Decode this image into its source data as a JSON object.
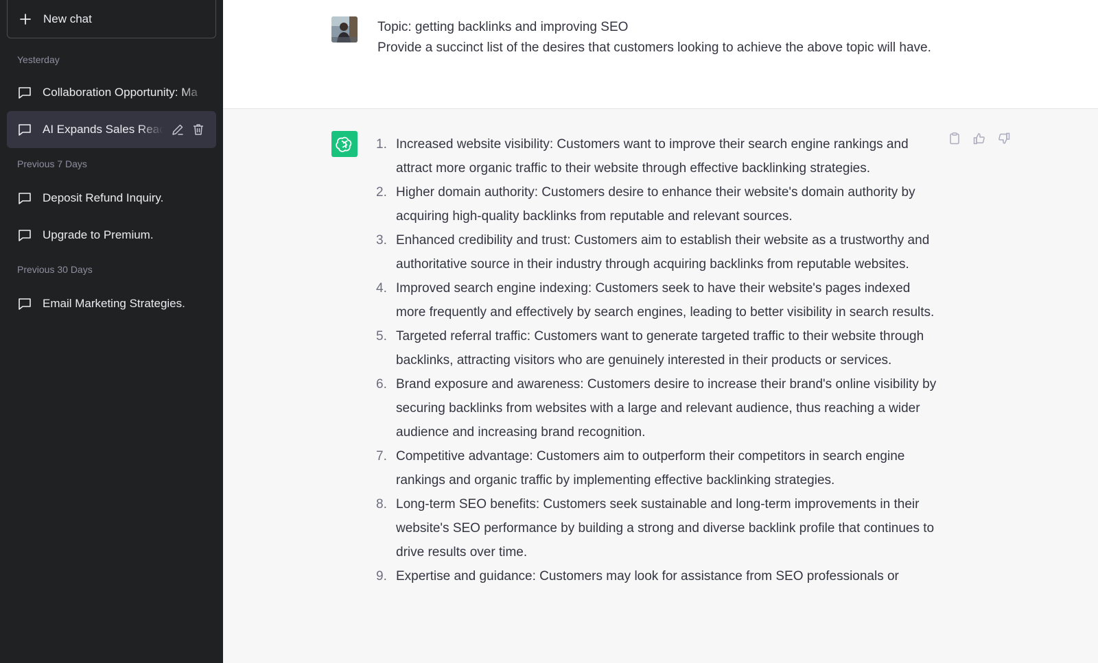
{
  "sidebar": {
    "new_chat_label": "New chat",
    "sections": [
      {
        "label": "Yesterday",
        "items": [
          {
            "label": "Collaboration Opportunity: Ma"
          },
          {
            "label": "AI Expands Sales Reac"
          }
        ]
      },
      {
        "label": "Previous 7 Days",
        "items": [
          {
            "label": "Deposit Refund Inquiry."
          },
          {
            "label": "Upgrade to Premium."
          }
        ]
      },
      {
        "label": "Previous 30 Days",
        "items": [
          {
            "label": "Email Marketing Strategies."
          }
        ]
      }
    ]
  },
  "conversation": {
    "user_message": {
      "line1": "Topic: getting backlinks and improving SEO",
      "line2": "Provide a succinct list of the desires that customers looking to achieve the above topic will have."
    },
    "assistant_items": [
      {
        "num": "1.",
        "text": "Increased website visibility: Customers want to improve their search engine rankings and attract more organic traffic to their website through effective backlinking strategies."
      },
      {
        "num": "2.",
        "text": "Higher domain authority: Customers desire to enhance their website's domain authority by acquiring high-quality backlinks from reputable and relevant sources."
      },
      {
        "num": "3.",
        "text": "Enhanced credibility and trust: Customers aim to establish their website as a trustworthy and authoritative source in their industry through acquiring backlinks from reputable websites."
      },
      {
        "num": "4.",
        "text": "Improved search engine indexing: Customers seek to have their website's pages indexed more frequently and effectively by search engines, leading to better visibility in search results."
      },
      {
        "num": "5.",
        "text": "Targeted referral traffic: Customers want to generate targeted traffic to their website through backlinks, attracting visitors who are genuinely interested in their products or services."
      },
      {
        "num": "6.",
        "text": "Brand exposure and awareness: Customers desire to increase their brand's online visibility by securing backlinks from websites with a large and relevant audience, thus reaching a wider audience and increasing brand recognition."
      },
      {
        "num": "7.",
        "text": "Competitive advantage: Customers aim to outperform their competitors in search engine rankings and organic traffic by implementing effective backlinking strategies."
      },
      {
        "num": "8.",
        "text": "Long-term SEO benefits: Customers seek sustainable and long-term improvements in their website's SEO performance by building a strong and diverse backlink profile that continues to drive results over time."
      },
      {
        "num": "9.",
        "text": "Expertise and guidance: Customers may look for assistance from SEO professionals or"
      }
    ]
  },
  "colors": {
    "sidebar_bg": "#202123",
    "active_item_bg": "#343541",
    "assistant_bg": "#f7f7f8",
    "bot_avatar": "#19c37d"
  }
}
